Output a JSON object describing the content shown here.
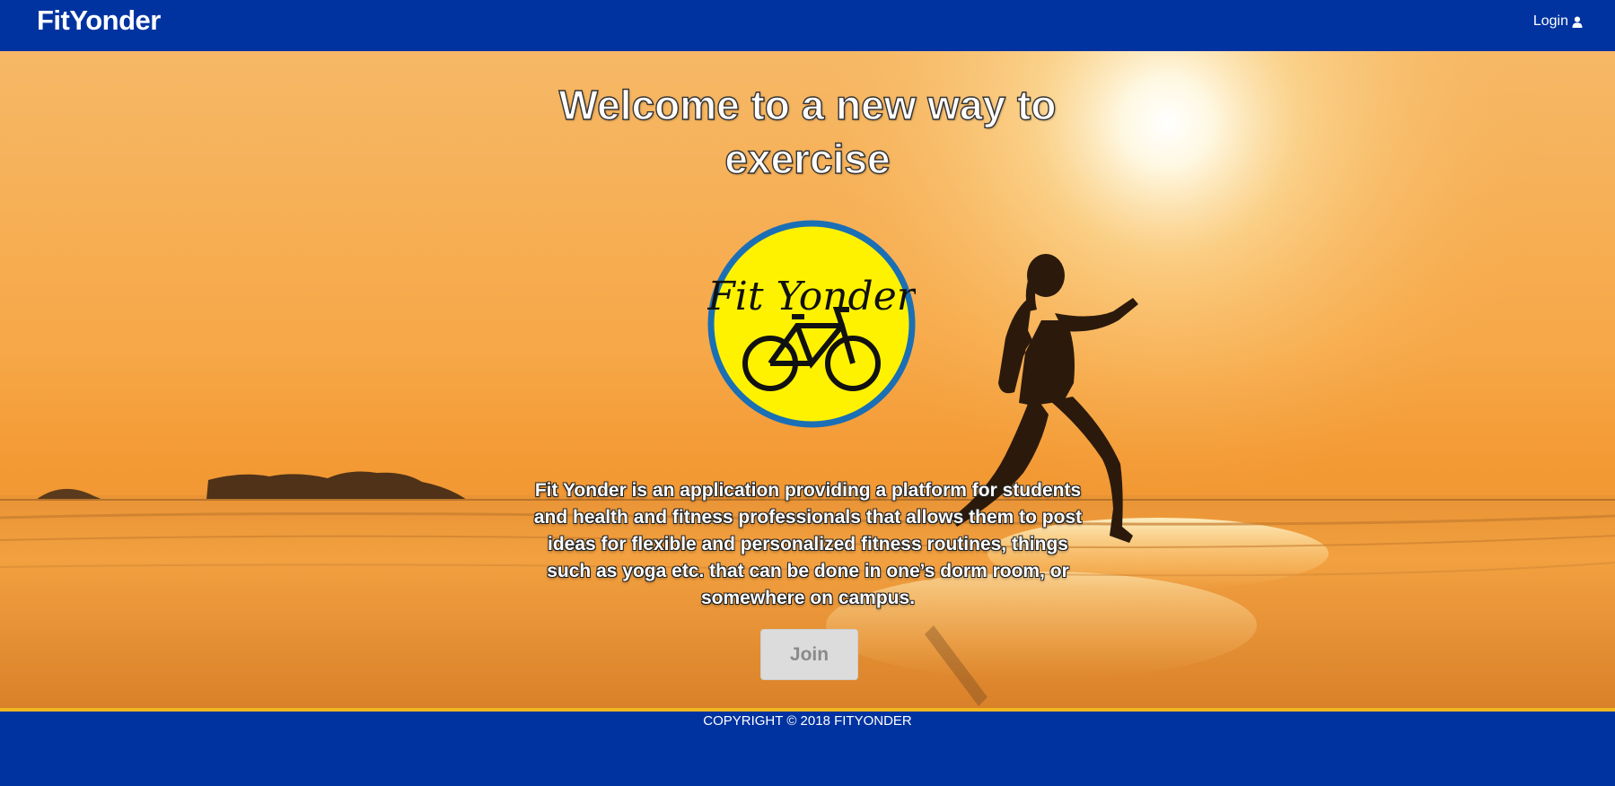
{
  "navbar": {
    "brand": "FitYonder",
    "login_label": "Login",
    "login_icon": "user-icon"
  },
  "hero": {
    "headline_line1": "Welcome to a new way to",
    "headline_line2": "exercise",
    "logo": {
      "text": "Fit Yonder",
      "icon": "bicycle-icon",
      "colors": {
        "fill": "#fff200",
        "ring": "#1a6fb5"
      }
    },
    "description": "Fit Yonder is an application providing a platform for students and health and fitness professionals that allows them to post ideas for flexible and personalized fitness routines, things such as yoga etc. that can be done in one’s dorm room, or somewhere on campus.",
    "join_label": "Join"
  },
  "footer": {
    "copyright": "COPYRIGHT © 2018 FITYONDER"
  },
  "colors": {
    "brand_blue": "#0033a0",
    "accent_gold": "#f2b622",
    "sunset_orange": "#f29a2e"
  }
}
